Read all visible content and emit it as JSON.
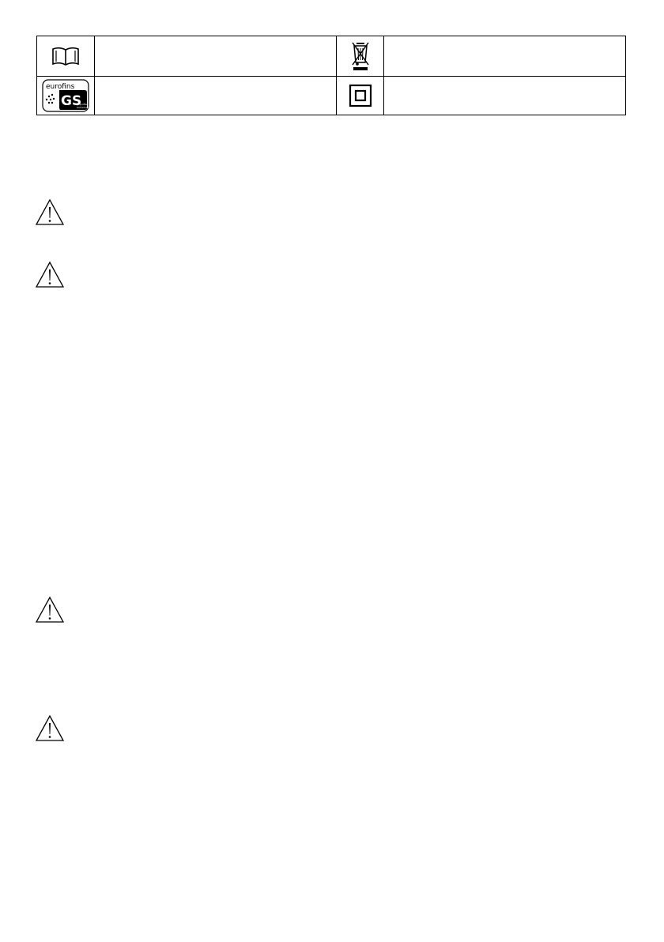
{
  "symbols_table": {
    "rows": [
      {
        "left_icon": "manual-book-icon",
        "left_text": "",
        "right_icon": "crossed-out-wheelie-bin-icon",
        "right_text": ""
      },
      {
        "left_icon": "eurofins-gs-mark",
        "left_logo_text": "eurofins",
        "left_logo_mark": "GS",
        "left_logo_sub": "geprüfte Sicherheit",
        "left_text": "",
        "right_icon": "double-insulation-icon",
        "right_text": ""
      }
    ]
  },
  "warnings": [
    {
      "icon": "warning-triangle-icon",
      "text": ""
    },
    {
      "icon": "warning-triangle-icon",
      "text": ""
    },
    {
      "icon": "warning-triangle-icon",
      "text": ""
    },
    {
      "icon": "warning-triangle-icon",
      "text": ""
    }
  ]
}
